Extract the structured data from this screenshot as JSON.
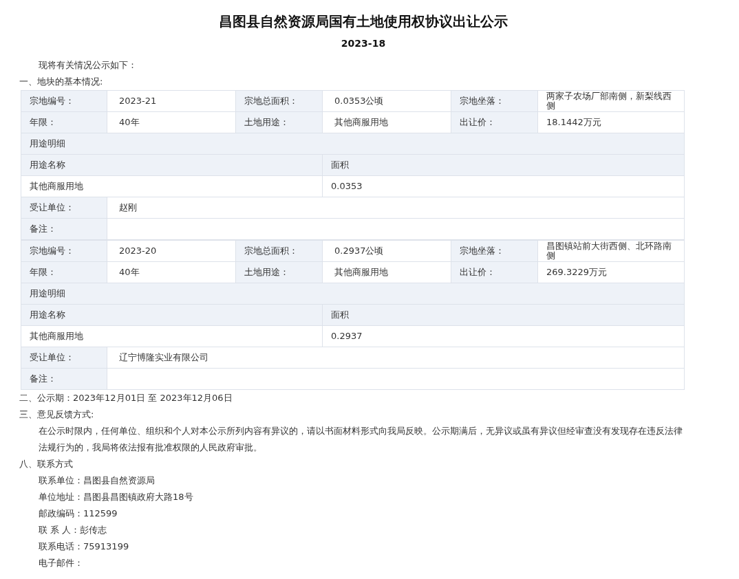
{
  "title": "昌图县自然资源局国有土地使用权协议出让公示",
  "subtitle": "2023-18",
  "intro": "现将有关情况公示如下：",
  "section_1": "一、地块的基本情况:",
  "parcels": [
    {
      "info_rows": [
        [
          {
            "label": "宗地编号：",
            "value": "2023-21"
          },
          {
            "label": "宗地总面积：",
            "value": "0.0353公顷"
          },
          {
            "label": "宗地坐落：",
            "value": "两家子农场厂部南侧，新梨线西侧"
          }
        ],
        [
          {
            "label": "年限：",
            "value": "40年"
          },
          {
            "label": "土地用途：",
            "value": "其他商服用地"
          },
          {
            "label": "出让价：",
            "value": "18.1442万元"
          }
        ]
      ],
      "detail_heading": "用途明细",
      "detail_columns": [
        "用途名称",
        "面积"
      ],
      "detail_rows": [
        [
          "其他商服用地",
          "0.0353"
        ]
      ],
      "assignee": {
        "label": "受让单位：",
        "value": "赵刚"
      },
      "remarks": {
        "label": "备注："
      }
    },
    {
      "info_rows": [
        [
          {
            "label": "宗地编号：",
            "value": "2023-20"
          },
          {
            "label": "宗地总面积：",
            "value": "0.2937公顷"
          },
          {
            "label": "宗地坐落：",
            "value": "昌图镇站前大街西侧、北环路南侧"
          }
        ],
        [
          {
            "label": "年限：",
            "value": "40年"
          },
          {
            "label": "土地用途：",
            "value": "其他商服用地"
          },
          {
            "label": "出让价：",
            "value": "269.3229万元"
          }
        ]
      ],
      "detail_heading": "用途明细",
      "detail_columns": [
        "用途名称",
        "面积"
      ],
      "detail_rows": [
        [
          "其他商服用地",
          "0.2937"
        ]
      ],
      "assignee": {
        "label": "受让单位：",
        "value": "辽宁博隆实业有限公司"
      },
      "remarks": {
        "label": "备注："
      }
    }
  ],
  "section_2": "二、公示期：2023年12月01日 至 2023年12月06日",
  "section_3": "三、意见反馈方式:",
  "feedback": "在公示时限内，任何单位、组织和个人对本公示所列内容有异议的，请以书面材料形式向我局反映。公示期满后，无异议或虽有异议但经审查没有发现存在违反法律法规行为的，我局将依法报有批准权限的人民政府审批。",
  "section_8": "八、联系方式",
  "contacts": [
    "联系单位：昌图县自然资源局",
    "单位地址：昌图县昌图镇政府大路18号",
    "邮政编码：112599",
    "联 系 人：彭传志",
    "联系电话：75913199",
    "电子邮件："
  ]
}
